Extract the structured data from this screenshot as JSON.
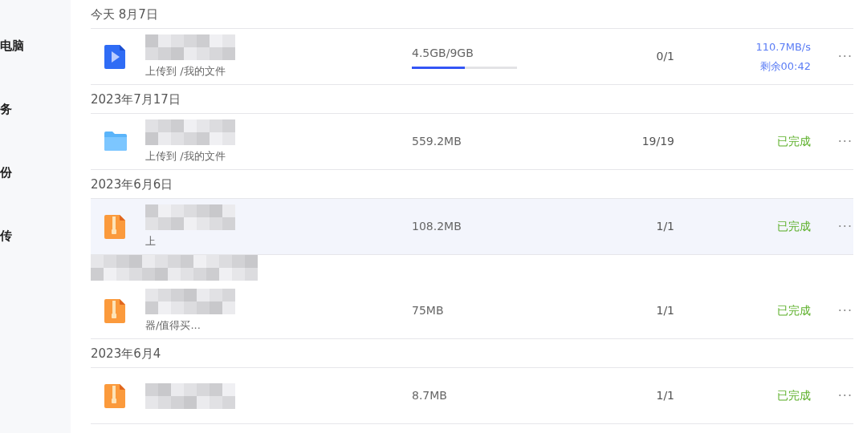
{
  "sidebar": {
    "items": [
      {
        "label": "电脑"
      },
      {
        "label": "务"
      },
      {
        "label": "份"
      },
      {
        "label": "传"
      }
    ]
  },
  "groups": [
    {
      "date": "今天 8月7日",
      "rows": [
        {
          "kind": "video",
          "subtitle": "上传到 /我的文件",
          "size": "4.5GB/9GB",
          "level": 0.5,
          "count": "0/1",
          "speed": "110.7MB/s",
          "remaining": "剩余00:42",
          "more": "···",
          "hovered": false
        }
      ]
    },
    {
      "date": "2023年7月17日",
      "rows": [
        {
          "kind": "folder",
          "subtitle": "上传到 /我的文件",
          "size": "559.2MB",
          "count": "19/19",
          "status": "已完成",
          "more": "···",
          "hovered": false
        }
      ]
    },
    {
      "date": "2023年6月6日",
      "rows": [
        {
          "kind": "zip",
          "subtitle": "上",
          "size": "108.2MB",
          "count": "1/1",
          "status": "已完成",
          "more": "···",
          "hovered": true
        }
      ]
    },
    {
      "rows": [
        {
          "kind": "zip",
          "subtitle": "器/值得买...",
          "size": "75MB",
          "count": "1/1",
          "status": "已完成",
          "more": "···",
          "hovered": false
        }
      ]
    },
    {
      "date": "2023年6月4",
      "rows": [
        {
          "kind": "zip",
          "size": "8.7MB",
          "count": "1/1",
          "status": "已完成",
          "more": "···",
          "hovered": false
        }
      ]
    }
  ]
}
